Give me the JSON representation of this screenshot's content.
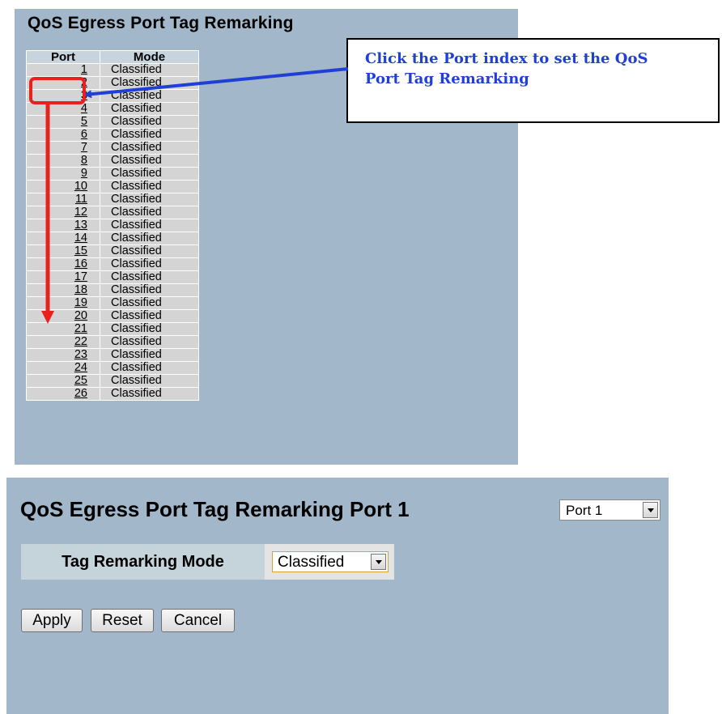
{
  "top": {
    "title": "QoS Egress Port Tag Remarking",
    "headers": {
      "port": "Port",
      "mode": "Mode"
    },
    "rows": [
      {
        "port": "1",
        "mode": "Classified"
      },
      {
        "port": "2",
        "mode": "Classified"
      },
      {
        "port": "3",
        "mode": "Classified"
      },
      {
        "port": "4",
        "mode": "Classified"
      },
      {
        "port": "5",
        "mode": "Classified"
      },
      {
        "port": "6",
        "mode": "Classified"
      },
      {
        "port": "7",
        "mode": "Classified"
      },
      {
        "port": "8",
        "mode": "Classified"
      },
      {
        "port": "9",
        "mode": "Classified"
      },
      {
        "port": "10",
        "mode": "Classified"
      },
      {
        "port": "11",
        "mode": "Classified"
      },
      {
        "port": "12",
        "mode": "Classified"
      },
      {
        "port": "13",
        "mode": "Classified"
      },
      {
        "port": "14",
        "mode": "Classified"
      },
      {
        "port": "15",
        "mode": "Classified"
      },
      {
        "port": "16",
        "mode": "Classified"
      },
      {
        "port": "17",
        "mode": "Classified"
      },
      {
        "port": "18",
        "mode": "Classified"
      },
      {
        "port": "19",
        "mode": "Classified"
      },
      {
        "port": "20",
        "mode": "Classified"
      },
      {
        "port": "21",
        "mode": "Classified"
      },
      {
        "port": "22",
        "mode": "Classified"
      },
      {
        "port": "23",
        "mode": "Classified"
      },
      {
        "port": "24",
        "mode": "Classified"
      },
      {
        "port": "25",
        "mode": "Classified"
      },
      {
        "port": "26",
        "mode": "Classified"
      }
    ]
  },
  "annotation": {
    "text_line1": "Click the Port index to set the QoS",
    "text_line2": "Port Tag Remarking",
    "text_color": "#1f3fd6",
    "arrow_colors": {
      "pointer": "#1f3fd6",
      "highlight": "#e8201e"
    }
  },
  "bottom": {
    "title": "QoS Egress Port Tag Remarking  Port 1",
    "port_select": {
      "value": "Port 1",
      "icon": "chevron-down-icon"
    },
    "mode_label": "Tag Remarking Mode",
    "mode_select": {
      "value": "Classified",
      "icon": "chevron-down-icon"
    },
    "buttons": {
      "apply": "Apply",
      "reset": "Reset",
      "cancel": "Cancel"
    }
  },
  "colors": {
    "panel_bg": "#a2b7c9",
    "header_bg": "#c7d4dd",
    "row_bg": "#d4d4d4"
  }
}
